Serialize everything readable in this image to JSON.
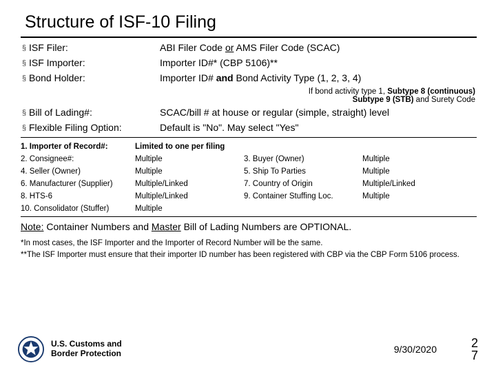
{
  "title": "Structure of ISF-10 Filing",
  "rows_top": [
    {
      "label": "ISF Filer:",
      "value_html": "ABI Filer Code <span class='und'>or</span> AMS Filer Code (SCAC)"
    },
    {
      "label": "ISF Importer:",
      "value": "Importer ID#* (CBP 5106)**"
    },
    {
      "label": "Bond Holder:",
      "value_html": "Importer ID# <b>and</b> Bond Activity Type (1, 2, 3, 4)"
    }
  ],
  "bond_note": {
    "line1_pre": "If bond activity  type 1, ",
    "line1_b": "Subtype 8 (continuous)",
    "line2_b": "Subtype 9 (STB)",
    "line2_post": "  and Surety Code"
  },
  "rows_mid": [
    {
      "label": "Bill of Lading#:",
      "value": "SCAC/bill # at house or regular (simple, straight) level"
    },
    {
      "label": "Flexible Filing Option:",
      "value": "Default is \"No\".  May select \"Yes\""
    }
  ],
  "data_table": [
    {
      "c1": "1. Importer of Record#:",
      "c2": "Limited to one per filing",
      "c3": "",
      "c4": "",
      "bold": true
    },
    {
      "c1": "2. Consignee#:",
      "c2": "Multiple",
      "c3": "3. Buyer (Owner)",
      "c4": "Multiple"
    },
    {
      "c1": "4. Seller (Owner)",
      "c2": "Multiple",
      "c3": "5. Ship To Parties",
      "c4": "Multiple"
    },
    {
      "c1": "6. Manufacturer (Supplier)",
      "c2": "Multiple/Linked",
      "c3": "7. Country of Origin",
      "c4": "Multiple/Linked"
    },
    {
      "c1": "8. HTS-6",
      "c2": "Multiple/Linked",
      "c3": "9. Container Stuffing Loc.",
      "c4": "Multiple"
    },
    {
      "c1": "10. Consolidator (Stuffer)",
      "c2": "Multiple",
      "c3": "",
      "c4": ""
    }
  ],
  "note_line_html": "<span class='und'>Note:</span> Container Numbers and <span class='und'>Master</span> Bill of Lading Numbers are OPTIONAL.",
  "footnote1": "*In most cases, the ISF Importer and the Importer of Record Number will be the same.",
  "footnote2": "**The ISF Importer must ensure that their importer ID number has been registered with CBP via the CBP Form 5106 process.",
  "agency": {
    "l1": "U.S. Customs and",
    "l2": "Border Protection"
  },
  "date": "9/30/2020",
  "page": {
    "a": "2",
    "b": "7"
  }
}
